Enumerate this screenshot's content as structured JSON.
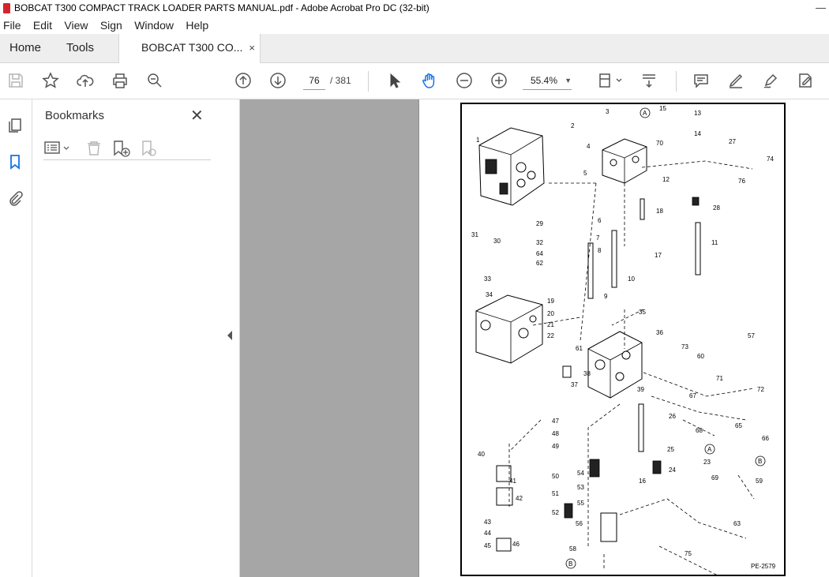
{
  "window": {
    "title": "BOBCAT T300 COMPACT TRACK LOADER PARTS MANUAL.pdf - Adobe Acrobat Pro DC (32-bit)",
    "minimize": "—"
  },
  "menu": [
    "File",
    "Edit",
    "View",
    "Sign",
    "Window",
    "Help"
  ],
  "tabs": {
    "home": "Home",
    "tools": "Tools",
    "document": "BOBCAT T300 CO...",
    "close": "×"
  },
  "toolbar": {
    "current_page": "76",
    "page_sep_total": "/  381",
    "zoom": "55.4%"
  },
  "bookmarks": {
    "title": "Bookmarks",
    "close": "✕"
  },
  "drawing": {
    "id": "PE-2579",
    "labels": [
      "1",
      "2",
      "3",
      "4",
      "5",
      "6",
      "7",
      "8",
      "9",
      "10",
      "11",
      "12",
      "13",
      "14",
      "15",
      "16",
      "17",
      "18",
      "19",
      "20",
      "21",
      "22",
      "23",
      "24",
      "25",
      "26",
      "27",
      "28",
      "29",
      "30",
      "31",
      "32",
      "33",
      "34",
      "35",
      "36",
      "37",
      "38",
      "39",
      "40",
      "41",
      "42",
      "43",
      "44",
      "45",
      "46",
      "47",
      "48",
      "49",
      "50",
      "51",
      "52",
      "53",
      "54",
      "55",
      "56",
      "57",
      "58",
      "59",
      "60",
      "61",
      "62",
      "63",
      "64",
      "65",
      "66",
      "67",
      "68",
      "69",
      "70",
      "71",
      "72",
      "73",
      "74",
      "75",
      "76",
      "A",
      "B"
    ]
  },
  "colors": {
    "accent": "#d8232a",
    "active_icon": "#1473e6",
    "gray_strip": "#a6a6a6"
  }
}
